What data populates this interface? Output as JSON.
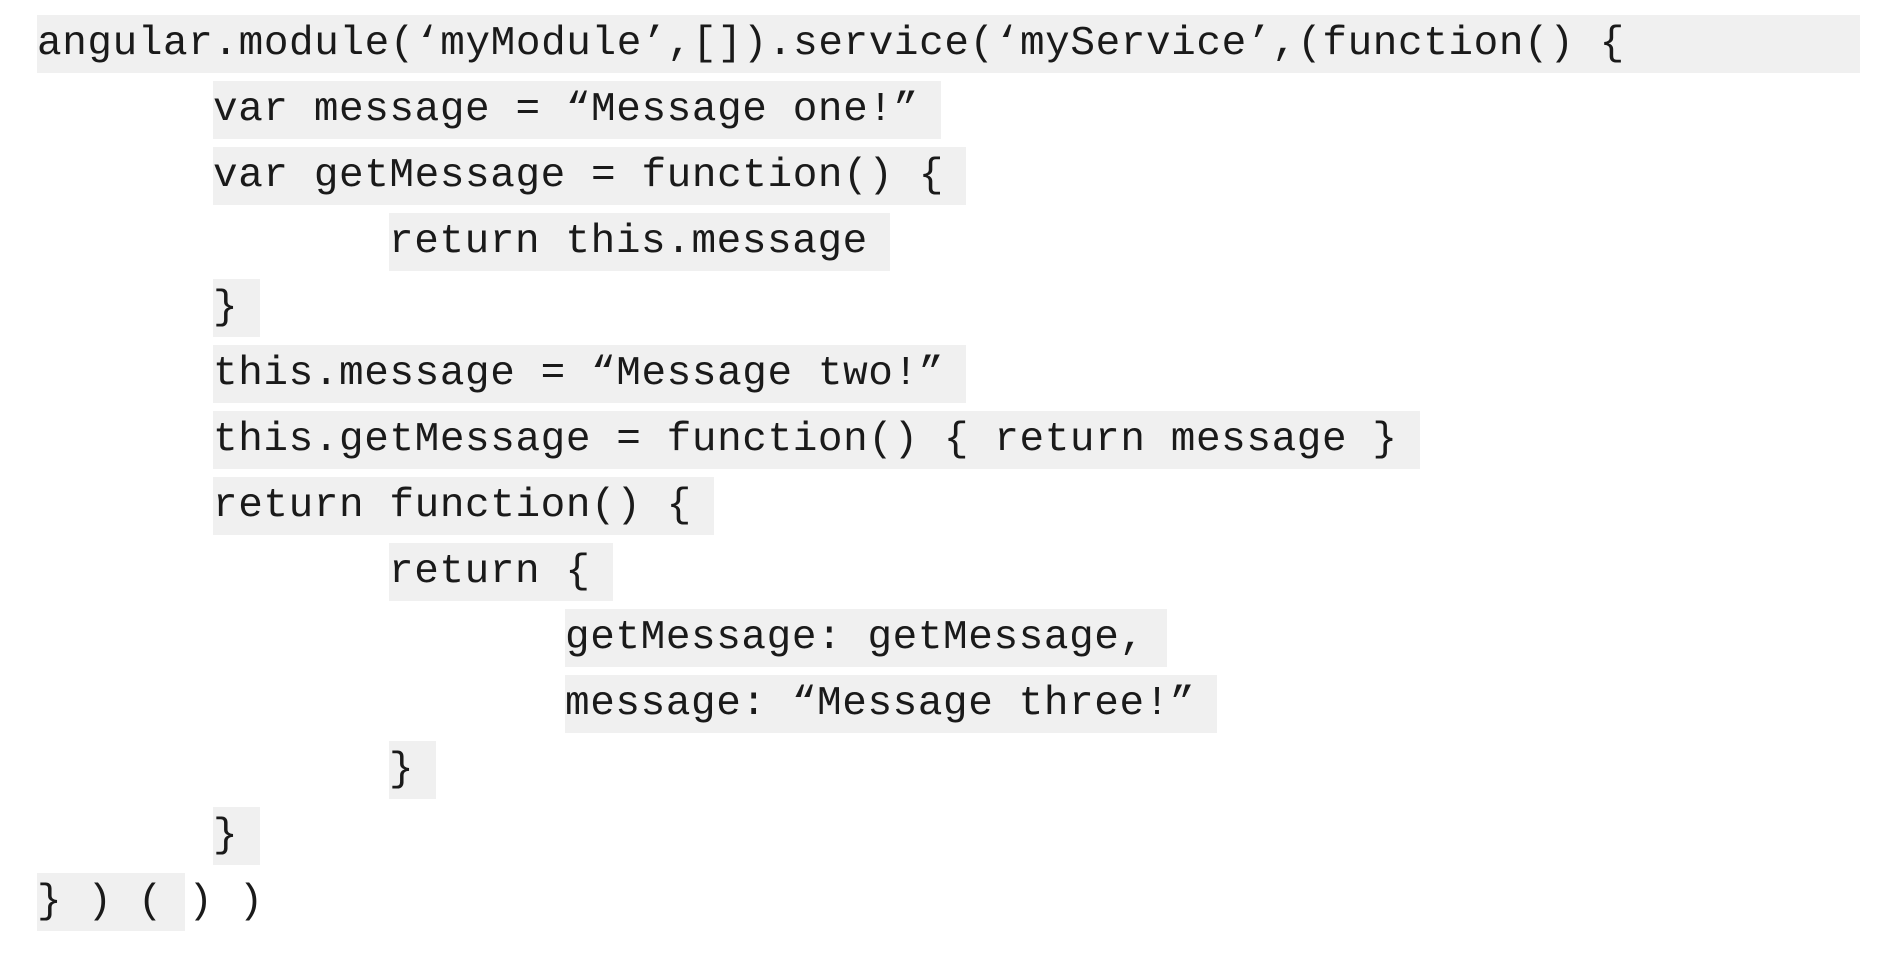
{
  "code": {
    "lines": [
      "angular.module(‘myModule’,[]).service(‘myService’,(function() {",
      "var message = “Message one!”",
      "var getMessage = function() {",
      "return this.message",
      "}",
      "this.message = “Message two!”",
      "this.getMessage = function() { return message }",
      "return function() {",
      "return {",
      "getMessage: getMessage,",
      "message: “Message three!”",
      "}",
      "}",
      "} ) ( ) )"
    ]
  }
}
